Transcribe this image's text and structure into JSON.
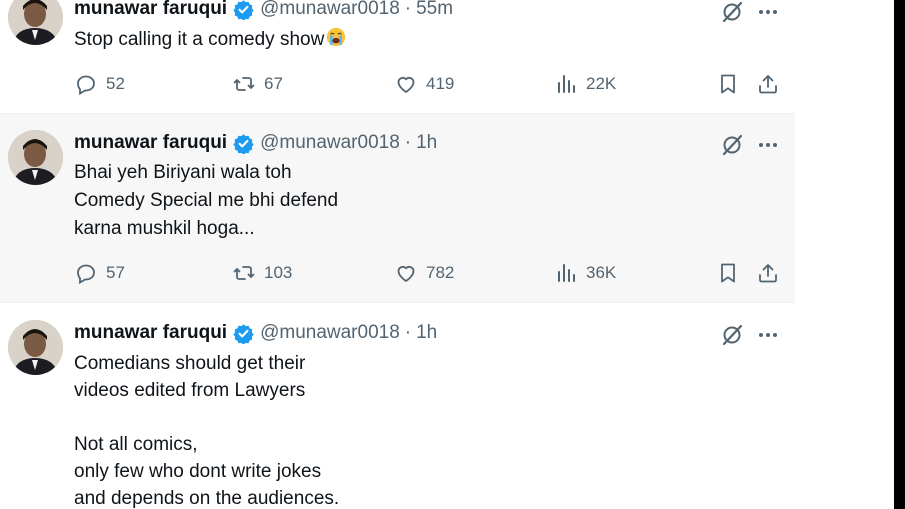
{
  "tweets": [
    {
      "name": "munawar faruqui",
      "handle": "@munawar0018",
      "separator": "·",
      "time": "55m",
      "text": "Stop calling it a comedy show",
      "emoji": "loudly-crying-face",
      "replies": "52",
      "reposts": "67",
      "likes": "419",
      "views": "22K"
    },
    {
      "name": "munawar faruqui",
      "handle": "@munawar0018",
      "separator": "·",
      "time": "1h",
      "text": "Bhai yeh Biriyani wala toh\nComedy Special me bhi defend\nkarna mushkil hoga...",
      "replies": "57",
      "reposts": "103",
      "likes": "782",
      "views": "36K"
    },
    {
      "name": "munawar faruqui",
      "handle": "@munawar0018",
      "separator": "·",
      "time": "1h",
      "text": "Comedians should get their\nvideos edited from Lawyers\n\nNot all comics,\nonly few who dont write jokes\nand depends on the audiences."
    }
  ],
  "colors": {
    "verified": "#1d9bf0",
    "secondary_text": "#536471",
    "highlight_bg": "#f7f7f7"
  }
}
